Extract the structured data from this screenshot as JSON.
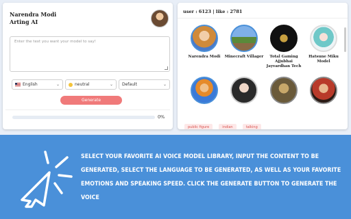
{
  "left_panel": {
    "model_name_line1": "Narendra Modi",
    "model_name_line2": "Arting AI",
    "textarea_placeholder": "Enter the text you want your model to say!",
    "language": "English",
    "emotion": "neutral",
    "speed": "Default",
    "generate_label": "Generate",
    "progress_percent": "0%",
    "progress_value": 0
  },
  "right_panel": {
    "stats": "user : 6123  |  like : 2781",
    "voices": [
      {
        "name": "Narendra Modi"
      },
      {
        "name": "Minecraft Villager"
      },
      {
        "name": "Total Gaming Ajjubhai Jayvardhan Tech"
      },
      {
        "name": "Hatsune Miku Model"
      },
      {
        "name": ""
      },
      {
        "name": ""
      },
      {
        "name": ""
      },
      {
        "name": ""
      }
    ],
    "tags": [
      "public figure",
      "indian",
      "talking"
    ]
  },
  "caption": "Select your favorite AI voice model library, input the content to be generated, select the language to be generated, as well as your favorite emotions and speaking speed. Click the generate button to generate the voice",
  "colors": {
    "accent": "#4a90d9",
    "button": "#f07a7a",
    "tag_bg": "#fde8e8",
    "tag_text": "#d9534f"
  },
  "icons": {
    "cursor": "pointer-click-icon",
    "dropdown": "chevron-down-icon"
  }
}
